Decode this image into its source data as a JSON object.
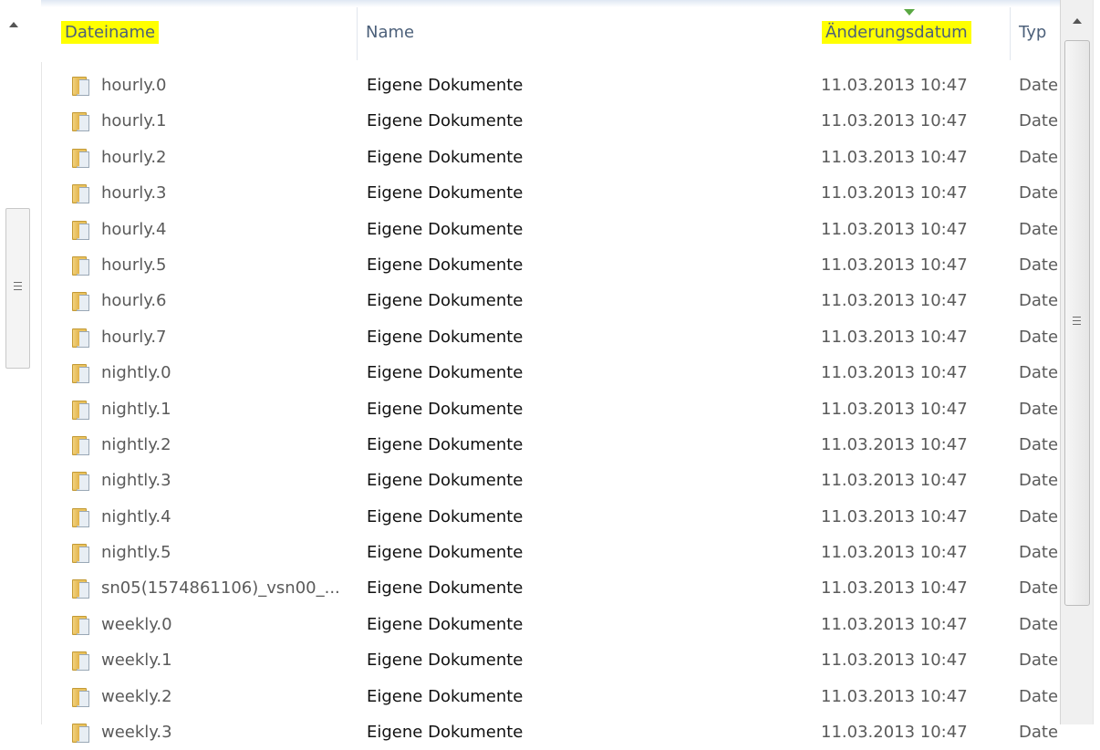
{
  "columns": [
    {
      "key": "file",
      "label": "Dateiname",
      "highlighted": true
    },
    {
      "key": "name",
      "label": "Name",
      "highlighted": false
    },
    {
      "key": "date",
      "label": "Änderungsdatum",
      "highlighted": true,
      "sorted": true
    },
    {
      "key": "typ",
      "label": "Typ",
      "highlighted": false
    }
  ],
  "rows": [
    {
      "file": "hourly.0",
      "name": "Eigene Dokumente",
      "date": "11.03.2013 10:47",
      "typ": "Date"
    },
    {
      "file": "hourly.1",
      "name": "Eigene Dokumente",
      "date": "11.03.2013 10:47",
      "typ": "Date"
    },
    {
      "file": "hourly.2",
      "name": "Eigene Dokumente",
      "date": "11.03.2013 10:47",
      "typ": "Date"
    },
    {
      "file": "hourly.3",
      "name": "Eigene Dokumente",
      "date": "11.03.2013 10:47",
      "typ": "Date"
    },
    {
      "file": "hourly.4",
      "name": "Eigene Dokumente",
      "date": "11.03.2013 10:47",
      "typ": "Date"
    },
    {
      "file": "hourly.5",
      "name": "Eigene Dokumente",
      "date": "11.03.2013 10:47",
      "typ": "Date"
    },
    {
      "file": "hourly.6",
      "name": "Eigene Dokumente",
      "date": "11.03.2013 10:47",
      "typ": "Date"
    },
    {
      "file": "hourly.7",
      "name": "Eigene Dokumente",
      "date": "11.03.2013 10:47",
      "typ": "Date"
    },
    {
      "file": "nightly.0",
      "name": "Eigene Dokumente",
      "date": "11.03.2013 10:47",
      "typ": "Date"
    },
    {
      "file": "nightly.1",
      "name": "Eigene Dokumente",
      "date": "11.03.2013 10:47",
      "typ": "Date"
    },
    {
      "file": "nightly.2",
      "name": "Eigene Dokumente",
      "date": "11.03.2013 10:47",
      "typ": "Date"
    },
    {
      "file": "nightly.3",
      "name": "Eigene Dokumente",
      "date": "11.03.2013 10:47",
      "typ": "Date"
    },
    {
      "file": "nightly.4",
      "name": "Eigene Dokumente",
      "date": "11.03.2013 10:47",
      "typ": "Date"
    },
    {
      "file": "nightly.5",
      "name": "Eigene Dokumente",
      "date": "11.03.2013 10:47",
      "typ": "Date"
    },
    {
      "file": "sn05(1574861106)_vsn00_...",
      "name": "Eigene Dokumente",
      "date": "11.03.2013 10:47",
      "typ": "Date"
    },
    {
      "file": "weekly.0",
      "name": "Eigene Dokumente",
      "date": "11.03.2013 10:47",
      "typ": "Date"
    },
    {
      "file": "weekly.1",
      "name": "Eigene Dokumente",
      "date": "11.03.2013 10:47",
      "typ": "Date"
    },
    {
      "file": "weekly.2",
      "name": "Eigene Dokumente",
      "date": "11.03.2013 10:47",
      "typ": "Date"
    },
    {
      "file": "weekly.3",
      "name": "Eigene Dokumente",
      "date": "11.03.2013 10:47",
      "typ": "Date"
    }
  ],
  "icons": {
    "row": "folder-icon",
    "header_sort": "sort-arrow-icon"
  },
  "colors": {
    "highlight": "#ffff00",
    "header_text": "#4c607a",
    "folder": "#e9c25e",
    "sort_arrow": "#5aa843"
  }
}
